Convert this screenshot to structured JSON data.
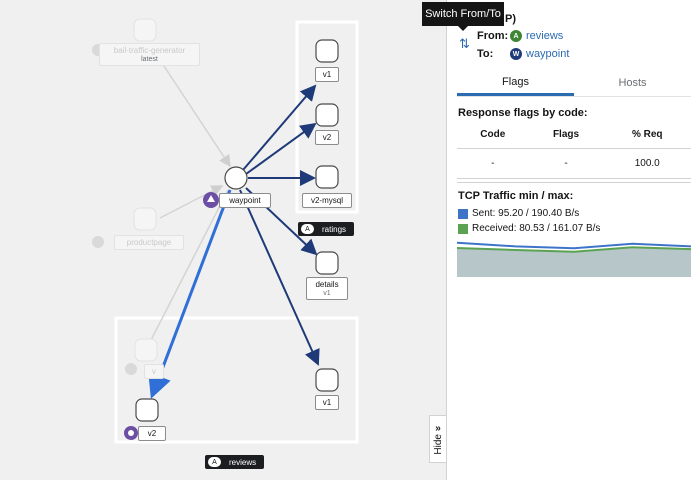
{
  "tooltip": "Switch From/To",
  "header": {
    "title": "P)",
    "from_label": "From:",
    "to_label": "To:",
    "from_icon": "A",
    "from_name": "reviews",
    "to_icon": "W",
    "to_name": "waypoint"
  },
  "tabs": [
    "Flags",
    "Hosts"
  ],
  "flags_section": {
    "title": "Response flags by code:",
    "headers": [
      "Code",
      "Flags",
      "% Req"
    ],
    "row": [
      "-",
      "-",
      "100.0"
    ]
  },
  "traffic": {
    "title": "TCP Traffic min / max:",
    "sent_label": "Sent: 95.20 / 190.40 B/s",
    "received_label": "Received: 80.53 / 161.07 B/s",
    "sent_color": "#3e74c8",
    "received_color": "#5ba352",
    "sent_series": [
      190.4,
      170,
      160,
      185,
      170
    ],
    "received_series": [
      161.07,
      150,
      140,
      165,
      155
    ]
  },
  "hide_label": "Hide",
  "graph": {
    "nodes": {
      "traffic_gen": "bail-traffic-generator",
      "traffic_gen_sub": "latest",
      "productpage": "productpage",
      "waypoint": "waypoint",
      "ratings_v1": "v1",
      "ratings_v2": "v2",
      "ratings_mysql": "v2-mysql",
      "details": "details",
      "details_ver": "v1",
      "reviews_v1": "v1",
      "reviews_v2": "v2",
      "reviews_faded": "v"
    },
    "badges": {
      "ratings": "ratings",
      "reviews": "reviews",
      "badge_icon": "A"
    }
  }
}
